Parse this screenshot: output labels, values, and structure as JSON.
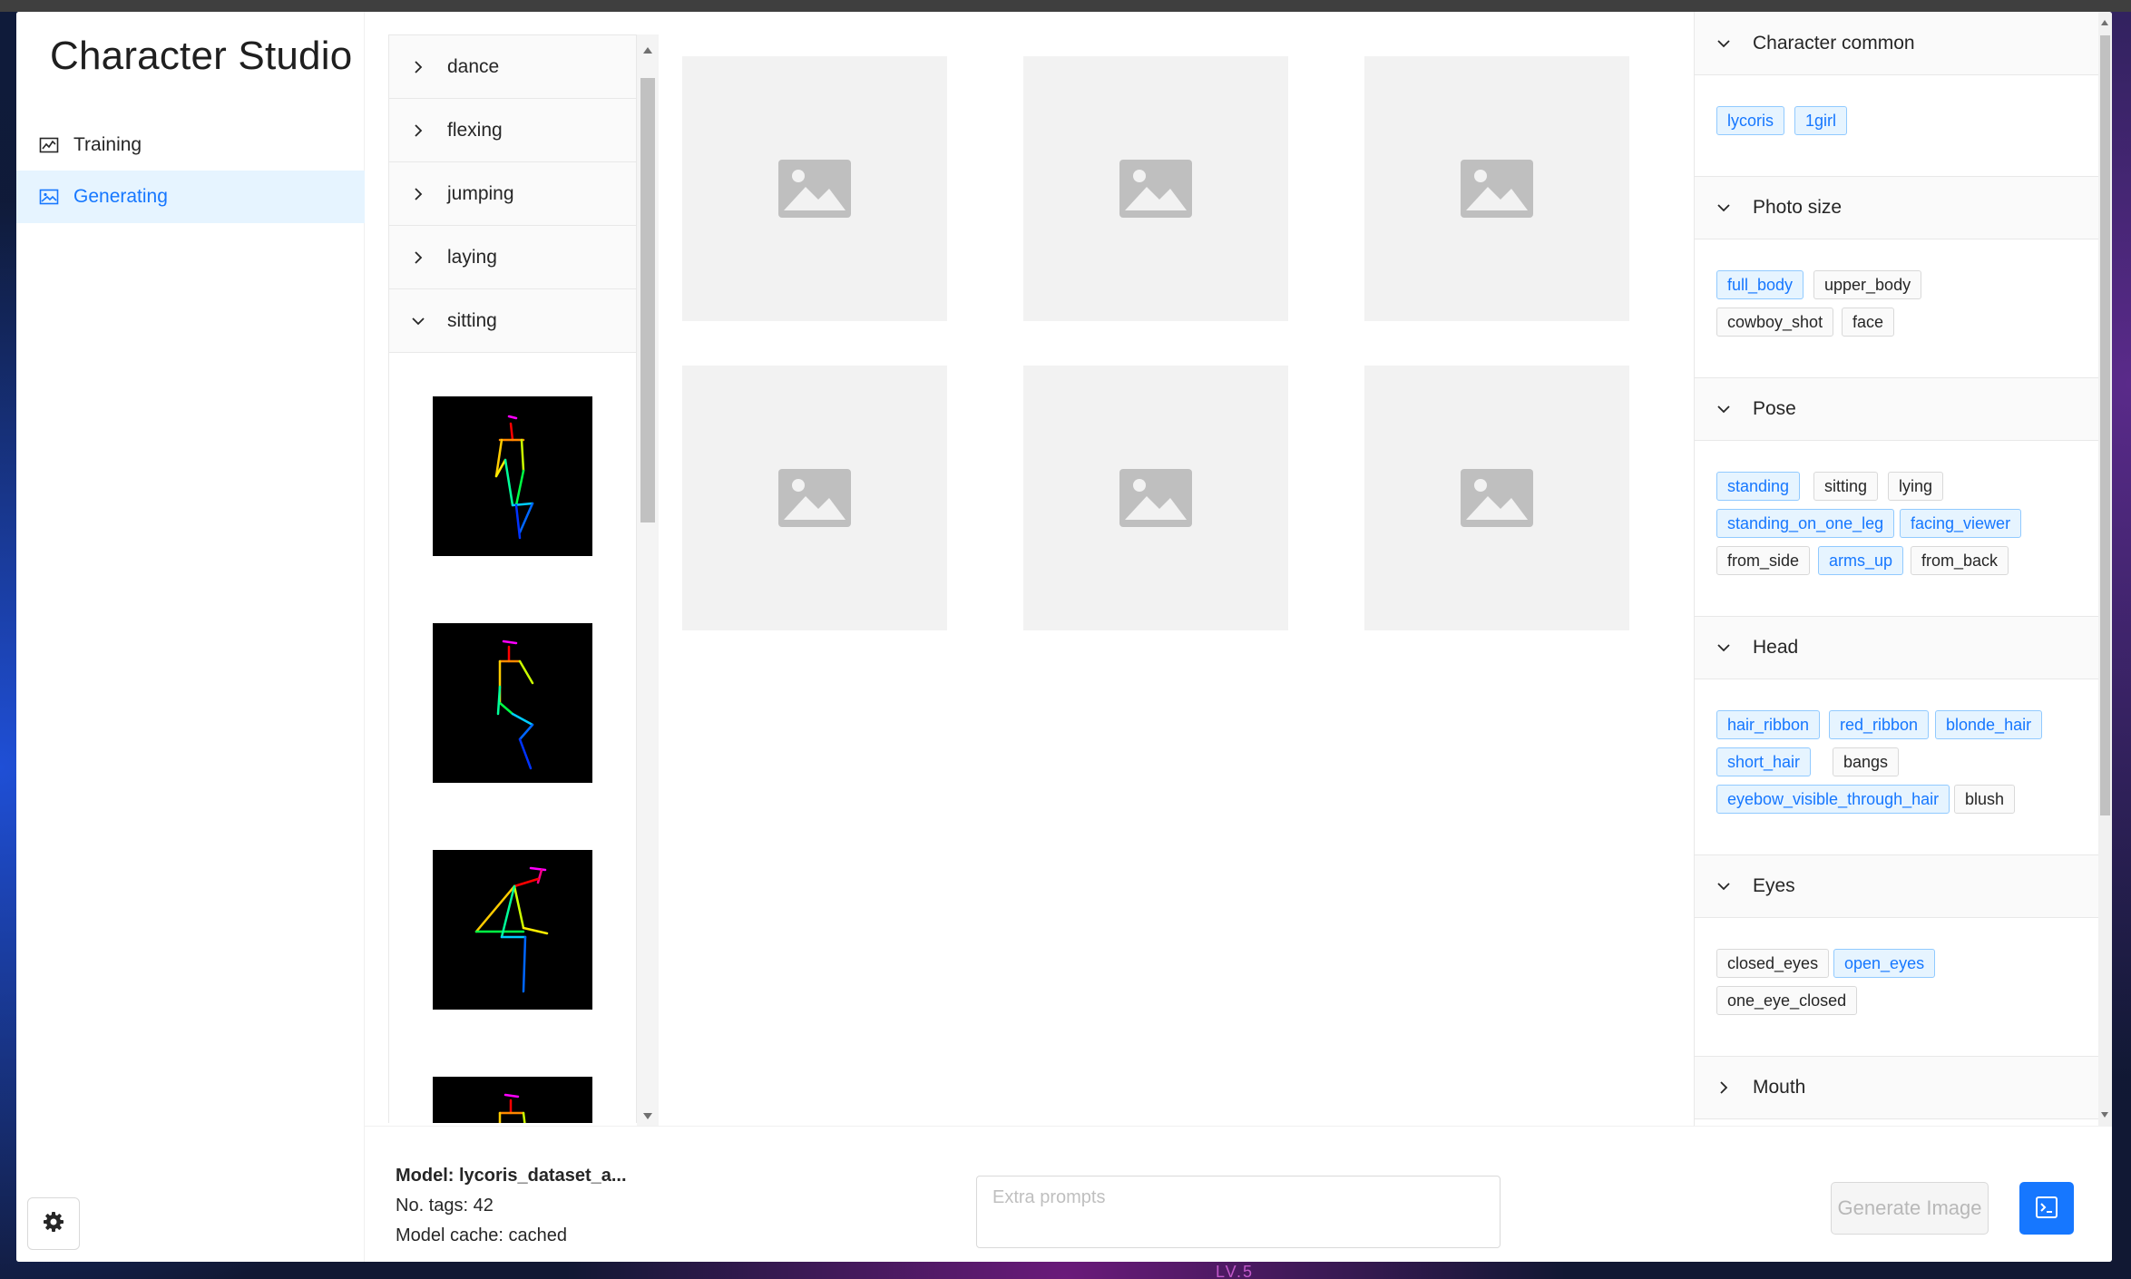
{
  "app": {
    "title": "Character Studio"
  },
  "nav": [
    {
      "label": "Training",
      "icon": "chart-icon",
      "active": false
    },
    {
      "label": "Generating",
      "icon": "image-icon",
      "active": true
    }
  ],
  "poses": {
    "groups": [
      {
        "label": "dance",
        "expanded": false
      },
      {
        "label": "flexing",
        "expanded": false
      },
      {
        "label": "jumping",
        "expanded": false
      },
      {
        "label": "laying",
        "expanded": false
      },
      {
        "label": "sitting",
        "expanded": true
      }
    ],
    "thumbnail_count_visible": 4
  },
  "gallery": {
    "placeholder_count": 6,
    "placeholder_icon": "image-placeholder-icon"
  },
  "tag_sections": [
    {
      "title": "Character common",
      "expanded": true,
      "tags": [
        {
          "label": "lycoris",
          "selected": true
        },
        {
          "label": "1girl",
          "selected": true
        }
      ]
    },
    {
      "title": "Photo size",
      "expanded": true,
      "tags": [
        {
          "label": "full_body",
          "selected": true
        },
        {
          "label": "upper_body",
          "selected": false
        },
        {
          "label": "cowboy_shot",
          "selected": false
        },
        {
          "label": "face",
          "selected": false
        }
      ]
    },
    {
      "title": "Pose",
      "expanded": true,
      "tags": [
        {
          "label": "standing",
          "selected": true
        },
        {
          "label": "sitting",
          "selected": false
        },
        {
          "label": "lying",
          "selected": false
        },
        {
          "label": "standing_on_one_leg",
          "selected": true
        },
        {
          "label": "facing_viewer",
          "selected": true
        },
        {
          "label": "from_side",
          "selected": false
        },
        {
          "label": "arms_up",
          "selected": true
        },
        {
          "label": "from_back",
          "selected": false
        }
      ]
    },
    {
      "title": "Head",
      "expanded": true,
      "tags": [
        {
          "label": "hair_ribbon",
          "selected": true
        },
        {
          "label": "red_ribbon",
          "selected": true
        },
        {
          "label": "blonde_hair",
          "selected": true
        },
        {
          "label": "short_hair",
          "selected": true
        },
        {
          "label": "bangs",
          "selected": false
        },
        {
          "label": "eyebow_visible_through_hair",
          "selected": true
        },
        {
          "label": "blush",
          "selected": false
        }
      ]
    },
    {
      "title": "Eyes",
      "expanded": true,
      "tags": [
        {
          "label": "closed_eyes",
          "selected": false
        },
        {
          "label": "open_eyes",
          "selected": true
        },
        {
          "label": "one_eye_closed",
          "selected": false
        }
      ]
    },
    {
      "title": "Mouth",
      "expanded": false,
      "tags": []
    }
  ],
  "status": {
    "model": "Model: lycoris_dataset_a...",
    "tags": "No. tags: 42",
    "cache": "Model cache: cached"
  },
  "extra_prompts": {
    "placeholder": "Extra prompts",
    "value": ""
  },
  "generate": {
    "label": "Generate Image",
    "enabled": false
  },
  "colors": {
    "accent": "#1677ff",
    "selected_tag_bg": "#e6f4ff",
    "selected_tag_border": "#91caff"
  },
  "desktop": {
    "background_text": "LV.5"
  }
}
